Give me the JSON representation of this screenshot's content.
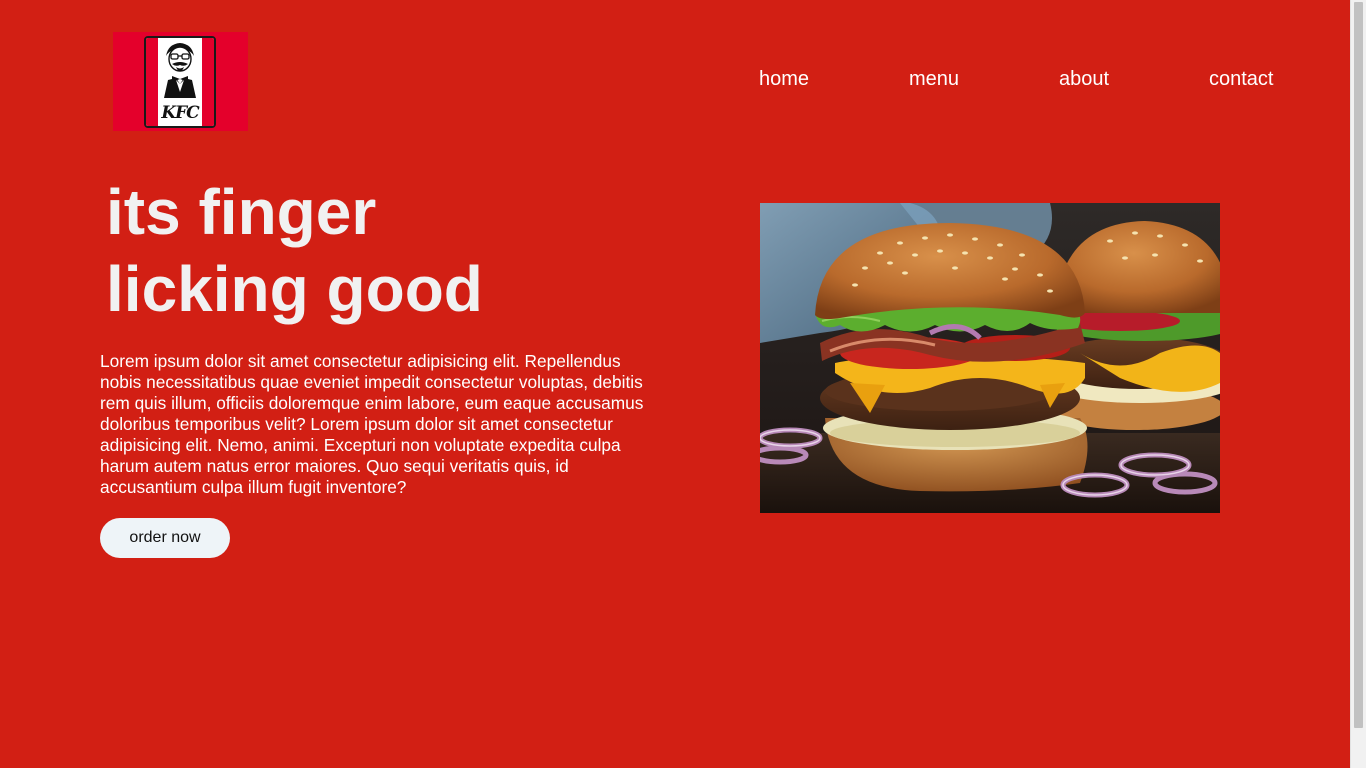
{
  "logo": {
    "text": "KFC",
    "icon": "kfc-colonel-logo"
  },
  "nav": {
    "items": [
      {
        "label": "home"
      },
      {
        "label": "menu"
      },
      {
        "label": "about"
      },
      {
        "label": "contact"
      }
    ]
  },
  "hero": {
    "title_line1": "its finger",
    "title_line2": "licking good",
    "description": "Lorem ipsum dolor sit amet consectetur adipisicing elit. Repellendus nobis necessitatibus quae eveniet impedit consectetur voluptas, debitis rem quis illum, officiis doloremque enim labore, eum eaque accusamus doloribus temporibus velit? Lorem ipsum dolor sit amet consectetur adipisicing elit. Nemo, animi. Excepturi non voluptate expedita culpa harum autem natus error maiores. Quo sequi veritatis quis, id accusantium culpa illum fugit inventore?",
    "button_label": "order now",
    "image": "burger-photo"
  },
  "colors": {
    "background": "#d21f14",
    "logo_red": "#e4002b",
    "text": "#ffffff",
    "button_bg": "#eef4f8"
  }
}
